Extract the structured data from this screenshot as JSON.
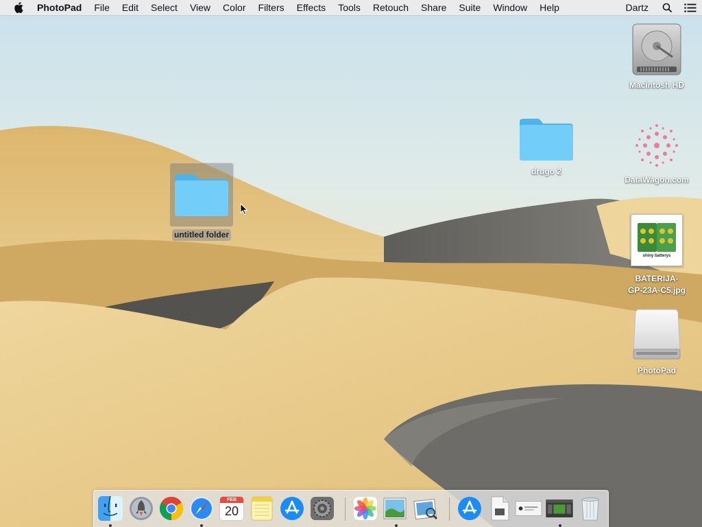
{
  "menubar": {
    "app_name": "PhotoPad",
    "menus": [
      "File",
      "Edit",
      "Select",
      "View",
      "Color",
      "Filters",
      "Effects",
      "Tools",
      "Retouch",
      "Share",
      "Suite",
      "Window",
      "Help"
    ],
    "right_items": {
      "user": "Dartz",
      "search_icon": "search-icon",
      "list_icon": "list-icon"
    }
  },
  "desktop": {
    "icons": {
      "macintosh_hd": "Macintosh HD",
      "drugo": "drugo 2",
      "datawagon": "DataWagon.com",
      "baterija_line1": "BATERIJA-",
      "baterija_line2": "GP-23A-C5.jpg",
      "photopad": "PhotoPad",
      "untitled_folder": "untitled folder"
    },
    "baterija_thumb_caption": "shiny batterys",
    "colors": {
      "folder_blue": "#5ec0f3",
      "sand": "#e2c07b",
      "shadow_dune": "#6f6e6a",
      "sky": "#d3e6ee"
    }
  },
  "dock": {
    "calendar_month": "FEB",
    "calendar_day": "20",
    "items": [
      "finder-icon",
      "launchpad-icon",
      "chrome-icon",
      "safari-icon",
      "calendar-icon",
      "notes-icon",
      "app-store-icon",
      "system-preferences-icon",
      "photos-icon",
      "image-viewer-icon",
      "preview-icon",
      "app-store-icon",
      "document-icon",
      "screenshot-icon",
      "photopad-window-icon",
      "trash-icon"
    ]
  }
}
